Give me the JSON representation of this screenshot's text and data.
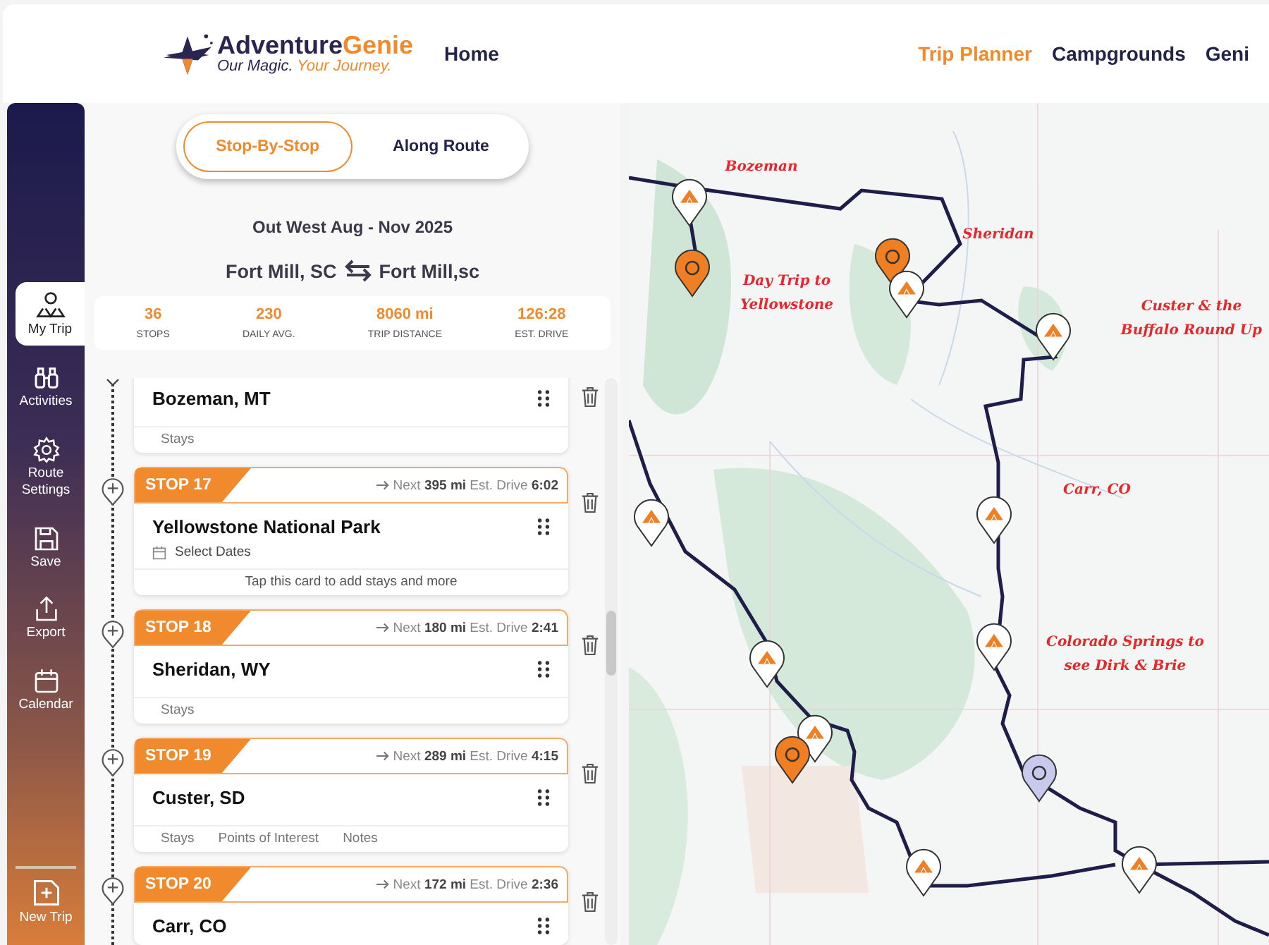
{
  "header": {
    "logo": {
      "brand_main": "Adventure",
      "brand_accent": "Genie",
      "tagline_main": "Our Magic.",
      "tagline_accent": "Your Journey."
    },
    "nav_left": [
      {
        "label": "Home",
        "selected": false
      }
    ],
    "nav_right": [
      {
        "label": "Trip Planner",
        "selected": true
      },
      {
        "label": "Campgrounds",
        "selected": false
      },
      {
        "label": "Geni",
        "selected": false
      }
    ]
  },
  "sidebar": {
    "items": [
      {
        "label": "My Trip",
        "kind": "trip",
        "selected": true
      },
      {
        "label": "Activities",
        "kind": "binoculars",
        "selected": false
      },
      {
        "label": "Route Settings",
        "kind": "gear",
        "selected": false
      },
      {
        "label": "Save",
        "kind": "save",
        "selected": false
      },
      {
        "label": "Export",
        "kind": "export",
        "selected": false
      },
      {
        "label": "Calendar",
        "kind": "calendar",
        "selected": false
      }
    ],
    "new_trip": {
      "label": "New Trip"
    }
  },
  "view_toggle": [
    {
      "label": "Stop-By-Stop",
      "selected": true
    },
    {
      "label": "Along Route",
      "selected": false
    }
  ],
  "trip": {
    "title": "Out West Aug - Nov 2025",
    "origin": "Fort Mill, SC",
    "destination": "Fort Mill,sc"
  },
  "stats": [
    {
      "value": "36",
      "label": "STOPS"
    },
    {
      "value": "230",
      "label": "DAILY AVG."
    },
    {
      "value": "8060 mi",
      "label": "TRIP DISTANCE"
    },
    {
      "value": "126:28",
      "label": "EST. DRIVE"
    }
  ],
  "stops": [
    {
      "name": "Bozeman, MT",
      "footer_tabs": [
        "Stays"
      ]
    },
    {
      "number": "STOP 17",
      "next_label": "Next",
      "distance": "395 mi",
      "drive_label": "Est. Drive",
      "drive": "6:02",
      "name": "Yellowstone National Park",
      "dates": "Select Dates",
      "hint": "Tap this card to add stays and more"
    },
    {
      "number": "STOP 18",
      "next_label": "Next",
      "distance": "180 mi",
      "drive_label": "Est. Drive",
      "drive": "2:41",
      "name": "Sheridan, WY",
      "footer_tabs": [
        "Stays"
      ]
    },
    {
      "number": "STOP 19",
      "next_label": "Next",
      "distance": "289 mi",
      "drive_label": "Est. Drive",
      "drive": "4:15",
      "name": "Custer, SD",
      "footer_tabs": [
        "Stays",
        "Points of Interest",
        "Notes"
      ]
    },
    {
      "number": "STOP 20",
      "next_label": "Next",
      "distance": "172 mi",
      "drive_label": "Est. Drive",
      "drive": "2:36",
      "name": "Carr, CO"
    }
  ],
  "map": {
    "notes": [
      "Bozeman",
      "Day Trip to Yellowstone",
      "Sheridan",
      "Custer & the Buffalo Round Up",
      "Carr, CO",
      "Colorado Springs to see Dirk & Brie"
    ]
  }
}
